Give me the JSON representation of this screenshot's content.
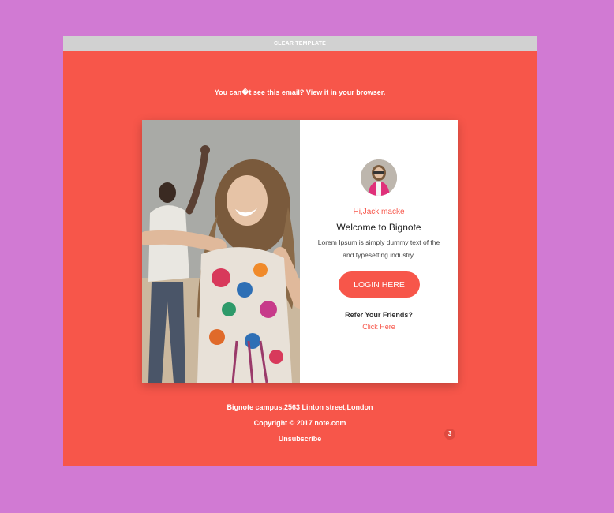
{
  "header": {
    "title": "CLEAR TEMPLATE"
  },
  "browser_notice": {
    "text": "You can�t see this email? ",
    "link": "View it in your browser."
  },
  "card": {
    "greeting": "Hi,Jack macke",
    "title": "Welcome to Bignote",
    "description": "Lorem Ipsum is simply dummy text of the and typesetting industry.",
    "login_label": "LOGIN HERE",
    "refer_label": "Refer Your Friends?",
    "click_label": "Click Here"
  },
  "footer": {
    "address": "Bignote campus,2563 Linton street,London",
    "copyright": "Copyright © 2017 note.com",
    "unsubscribe": "Unsubscribe"
  },
  "badge": {
    "count": "3"
  },
  "colors": {
    "accent": "#f7564a",
    "background": "#d17ad3",
    "topbar": "#d1d1d1",
    "card": "#ffffff"
  }
}
